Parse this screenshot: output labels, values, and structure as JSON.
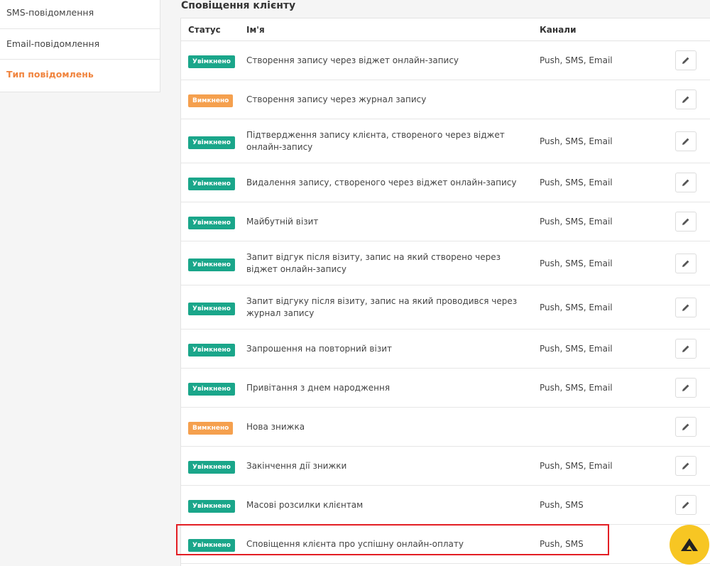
{
  "sidebar": {
    "items": [
      {
        "label": "SMS-повідомлення",
        "active": false
      },
      {
        "label": "Email-повідомлення",
        "active": false
      },
      {
        "label": "Тип повідомлень",
        "active": true
      }
    ]
  },
  "section": {
    "title": "Сповіщення клієнту"
  },
  "table": {
    "headers": {
      "status": "Статус",
      "name": "Ім'я",
      "channels": "Канали"
    },
    "rows": [
      {
        "status": "Увімкнено",
        "state": "on",
        "name": "Створення запису через віджет онлайн-запису",
        "channels": "Push, SMS, Email"
      },
      {
        "status": "Вимкнено",
        "state": "off",
        "name": "Створення запису через журнал запису",
        "channels": ""
      },
      {
        "status": "Увімкнено",
        "state": "on",
        "name": "Підтвердження запису клієнта, створеного через віджет онлайн-запису",
        "channels": "Push, SMS, Email"
      },
      {
        "status": "Увімкнено",
        "state": "on",
        "name": "Видалення запису, створеного через віджет онлайн-запису",
        "channels": "Push, SMS, Email"
      },
      {
        "status": "Увімкнено",
        "state": "on",
        "name": "Майбутній візит",
        "channels": "Push, SMS, Email"
      },
      {
        "status": "Увімкнено",
        "state": "on",
        "name": "Запит відгук після візиту, запис на який створено через віджет онлайн-запису",
        "channels": "Push, SMS, Email"
      },
      {
        "status": "Увімкнено",
        "state": "on",
        "name": "Запит відгуку після візиту, запис на який проводився через журнал запису",
        "channels": "Push, SMS, Email"
      },
      {
        "status": "Увімкнено",
        "state": "on",
        "name": "Запрошення на повторний візит",
        "channels": "Push, SMS, Email"
      },
      {
        "status": "Увімкнено",
        "state": "on",
        "name": "Привітання з днем народження",
        "channels": "Push, SMS, Email"
      },
      {
        "status": "Вимкнено",
        "state": "off",
        "name": "Нова знижка",
        "channels": ""
      },
      {
        "status": "Увімкнено",
        "state": "on",
        "name": "Закінчення дії знижки",
        "channels": "Push, SMS, Email"
      },
      {
        "status": "Увімкнено",
        "state": "on",
        "name": "Масові розсилки клієнтам",
        "channels": "Push, SMS"
      },
      {
        "status": "Увімкнено",
        "state": "on",
        "name": "Сповіщення клієнта про успішну онлайн-оплату",
        "channels": "Push, SMS"
      }
    ]
  },
  "colors": {
    "on": "#1aa68a",
    "off": "#f5a04e",
    "accent": "#f0843e",
    "highlight": "#e31e24",
    "fab": "#f7c623"
  },
  "icons": {
    "edit": "pencil-icon",
    "fab": "logo-triangle-icon"
  }
}
